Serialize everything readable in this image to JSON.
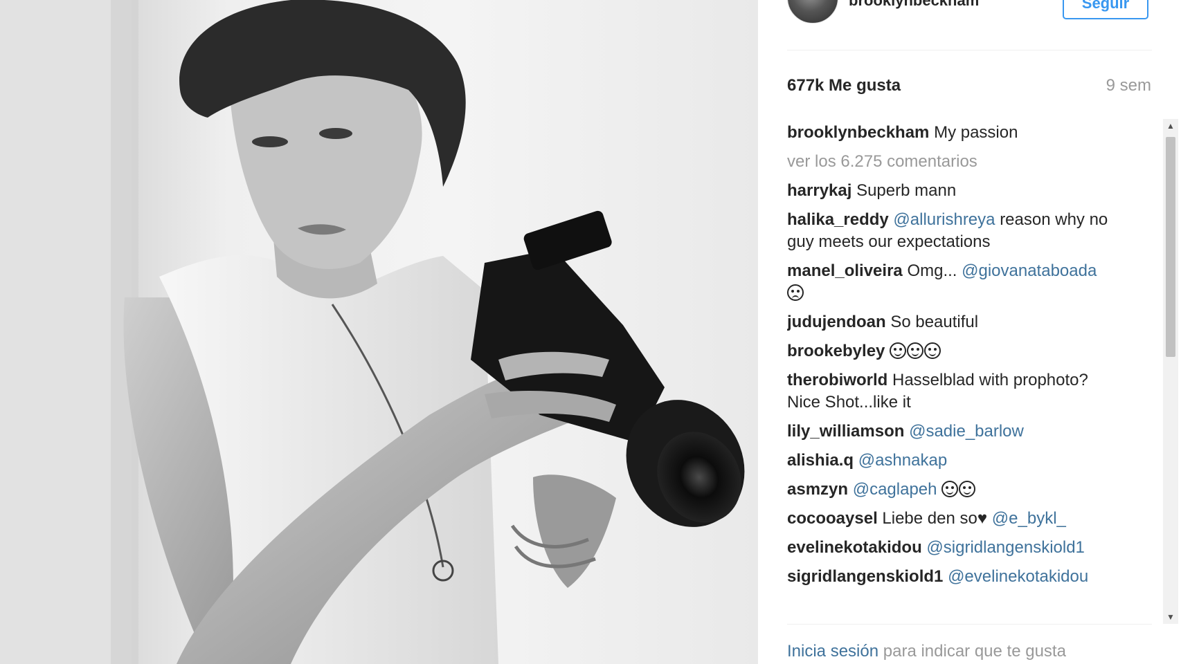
{
  "post": {
    "author": "brooklynbeckham",
    "follow_label": "Seguir",
    "likes": "677k Me gusta",
    "time_ago": "9 sem"
  },
  "caption": {
    "user": "brooklynbeckham",
    "text": "My passion"
  },
  "view_all_comments": "ver los 6.275 comentarios",
  "comments": [
    {
      "user": "harrykaj",
      "text": "Superb mann"
    },
    {
      "user": "halika_reddy",
      "mention": "@allurishreya",
      "text": "reason why no guy meets our expectations"
    },
    {
      "user": "manel_oliveira",
      "text": "Omg...",
      "mention": "@giovanataboada",
      "emoji": "frown"
    },
    {
      "user": "judujendoan",
      "text": "So beautiful"
    },
    {
      "user": "brookebyley",
      "emoji_count": 3
    },
    {
      "user": "therobiworld",
      "text": "Hasselblad with prophoto? Nice Shot...like it"
    },
    {
      "user": "lily_williamson",
      "mention": "@sadie_barlow"
    },
    {
      "user": "alishia.q",
      "mention": "@ashnakap"
    },
    {
      "user": "asmzyn",
      "mention": "@caglapeh",
      "emoji_count": 2
    },
    {
      "user": "cocooaysel",
      "text": "Liebe den so",
      "heart": "♥",
      "mention": "@e_bykl_"
    },
    {
      "user": "evelinekotakidou",
      "mention": "@sigridlangenskiold1"
    },
    {
      "user": "sigridlangenskiold1",
      "mention": "@evelinekotakidou"
    }
  ],
  "footer": {
    "login_link": "Inicia sesión",
    "login_rest": "para indicar que te gusta"
  },
  "scrollbar": {
    "up": "▲",
    "down": "▼"
  },
  "colors": {
    "link": "#3f729b",
    "follow": "#3897f0",
    "muted": "#999999",
    "text": "#262626"
  }
}
